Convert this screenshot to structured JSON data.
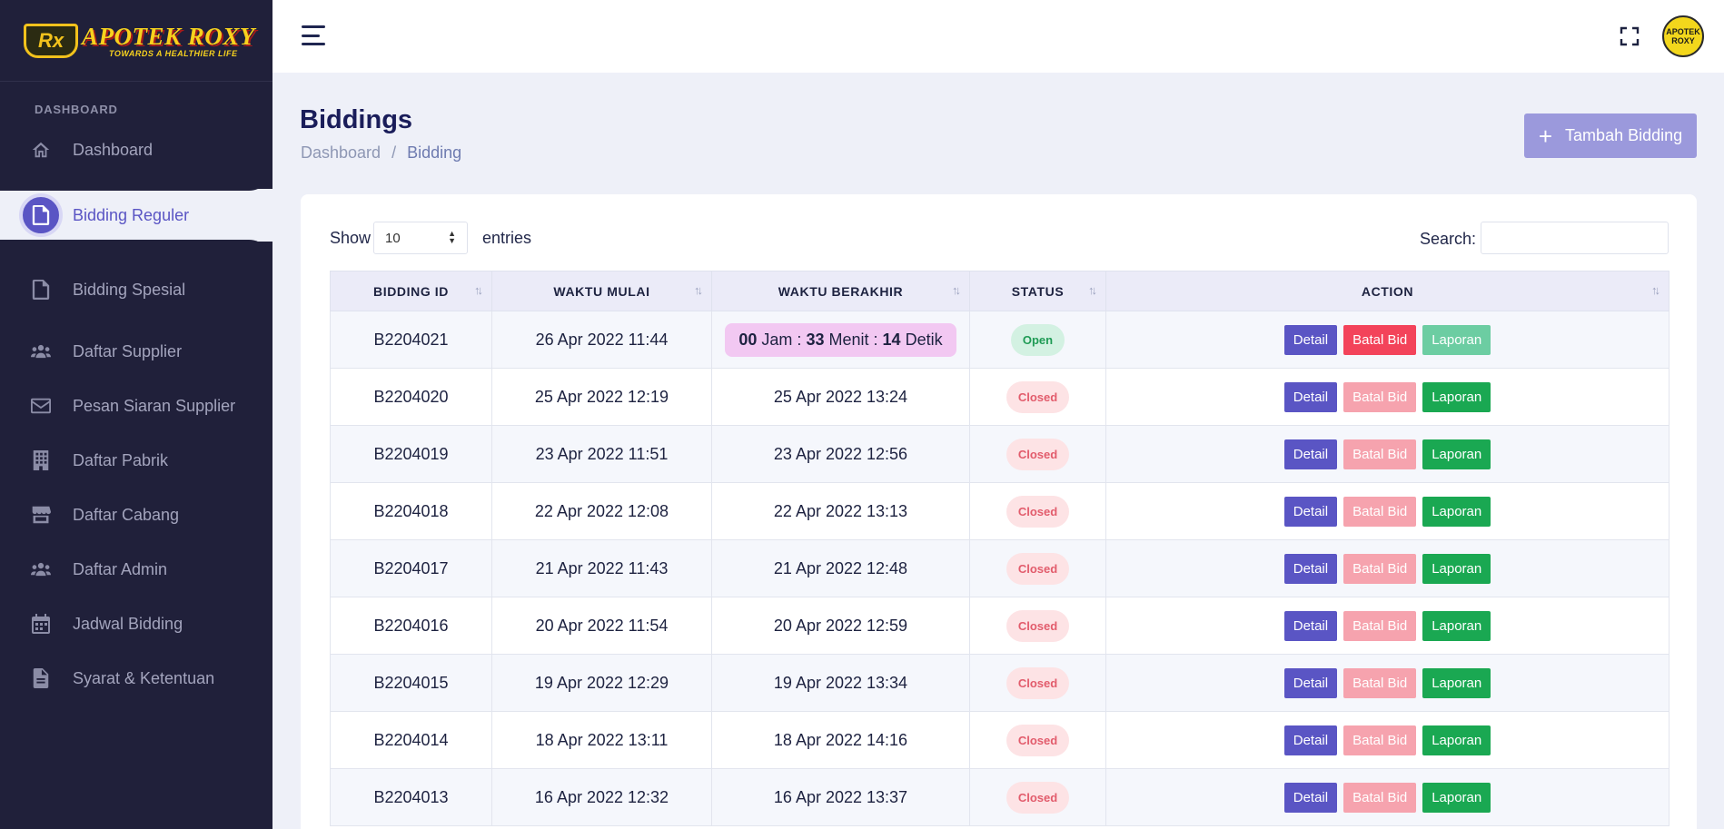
{
  "brand": {
    "name": "APOTEK ROXY",
    "tagline": "TOWARDS A HEALTHIER LIFE",
    "avatar_line1": "APOTEK",
    "avatar_line2": "ROXY"
  },
  "sidebar": {
    "section_label": "DASHBOARD",
    "items": [
      {
        "label": "Dashboard",
        "icon": "home-icon"
      },
      {
        "label": "Bidding Reguler",
        "icon": "file-icon",
        "active": true
      },
      {
        "label": "Bidding Spesial",
        "icon": "file-icon"
      },
      {
        "label": "Daftar Supplier",
        "icon": "users-icon"
      },
      {
        "label": "Pesan Siaran Supplier",
        "icon": "envelope-icon"
      },
      {
        "label": "Daftar Pabrik",
        "icon": "building-icon"
      },
      {
        "label": "Daftar Cabang",
        "icon": "store-icon"
      },
      {
        "label": "Daftar Admin",
        "icon": "users-icon"
      },
      {
        "label": "Jadwal Bidding",
        "icon": "calendar-icon"
      },
      {
        "label": "Syarat & Ketentuan",
        "icon": "document-icon"
      }
    ]
  },
  "page": {
    "title": "Biddings",
    "breadcrumb": [
      "Dashboard",
      "Bidding"
    ],
    "add_button": "Tambah Bidding"
  },
  "table_controls": {
    "show_label": "Show",
    "show_value": "10",
    "entries_label": "entries",
    "search_label": "Search:",
    "search_value": ""
  },
  "table": {
    "headers": [
      "BIDDING ID",
      "WAKTU MULAI",
      "WAKTU BERAKHIR",
      "STATUS",
      "ACTION"
    ],
    "countdown": {
      "jam": "00",
      "jam_label": "Jam :",
      "menit": "33",
      "menit_label": "Menit :",
      "detik": "14",
      "detik_label": "Detik"
    },
    "actions": {
      "detail": "Detail",
      "batal": "Batal Bid",
      "laporan": "Laporan"
    },
    "rows": [
      {
        "id": "B2204021",
        "mulai": "26 Apr 2022 11:44",
        "berakhir": "",
        "status": "Open"
      },
      {
        "id": "B2204020",
        "mulai": "25 Apr 2022 12:19",
        "berakhir": "25 Apr 2022 13:24",
        "status": "Closed"
      },
      {
        "id": "B2204019",
        "mulai": "23 Apr 2022 11:51",
        "berakhir": "23 Apr 2022 12:56",
        "status": "Closed"
      },
      {
        "id": "B2204018",
        "mulai": "22 Apr 2022 12:08",
        "berakhir": "22 Apr 2022 13:13",
        "status": "Closed"
      },
      {
        "id": "B2204017",
        "mulai": "21 Apr 2022 11:43",
        "berakhir": "21 Apr 2022 12:48",
        "status": "Closed"
      },
      {
        "id": "B2204016",
        "mulai": "20 Apr 2022 11:54",
        "berakhir": "20 Apr 2022 12:59",
        "status": "Closed"
      },
      {
        "id": "B2204015",
        "mulai": "19 Apr 2022 12:29",
        "berakhir": "19 Apr 2022 13:34",
        "status": "Closed"
      },
      {
        "id": "B2204014",
        "mulai": "18 Apr 2022 13:11",
        "berakhir": "18 Apr 2022 14:16",
        "status": "Closed"
      },
      {
        "id": "B2204013",
        "mulai": "16 Apr 2022 12:32",
        "berakhir": "16 Apr 2022 13:37",
        "status": "Closed"
      }
    ]
  },
  "colors": {
    "sidebar_bg": "#20203a",
    "accent": "#5a55c4",
    "page_bg": "#eef0f8",
    "success": "#1aa852",
    "danger": "#f3435a"
  }
}
